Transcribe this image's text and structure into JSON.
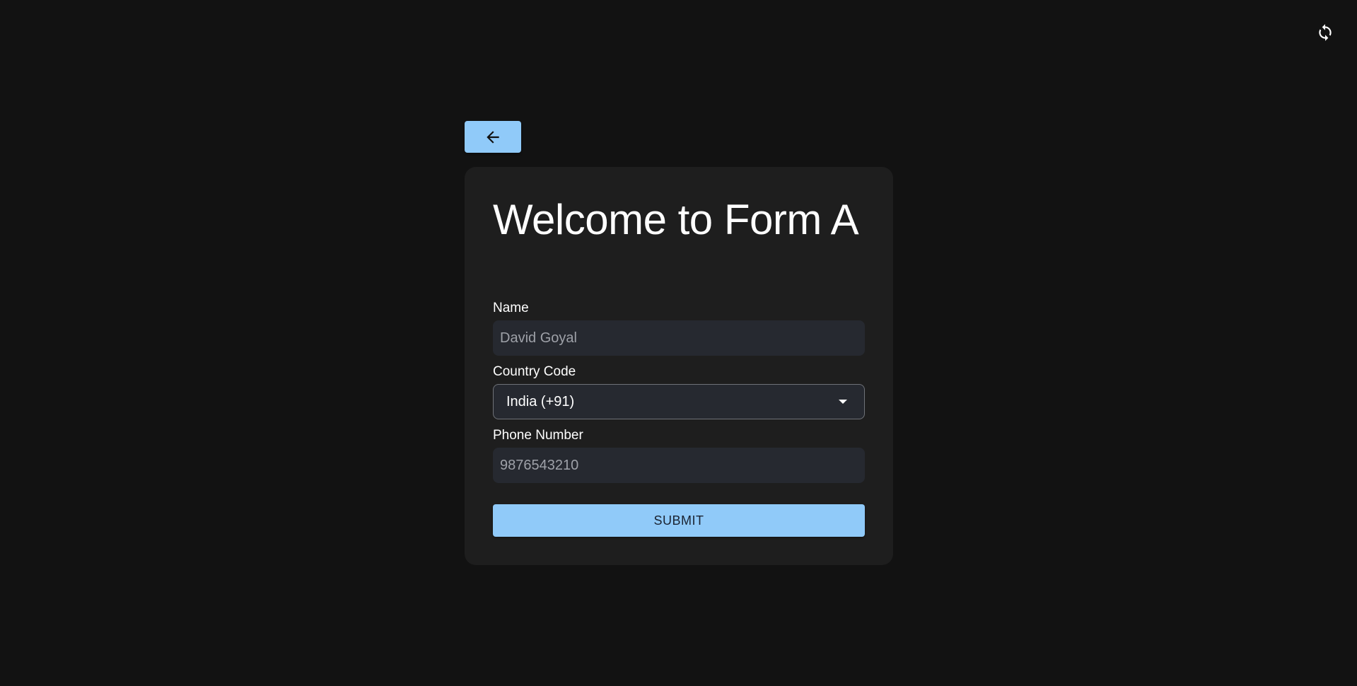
{
  "header": {
    "refresh_icon": "refresh-icon"
  },
  "back_button": {
    "icon": "arrow-left-icon"
  },
  "form": {
    "title": "Welcome to Form A",
    "name": {
      "label": "Name",
      "placeholder": "David Goyal"
    },
    "country_code": {
      "label": "Country Code",
      "selected": "India (+91)"
    },
    "phone": {
      "label": "Phone Number",
      "placeholder": "9876543210"
    },
    "submit_label": "SUBMIT"
  },
  "colors": {
    "background": "#121212",
    "card": "#1e1e1e",
    "input": "#262930",
    "accent": "#90caf9"
  }
}
